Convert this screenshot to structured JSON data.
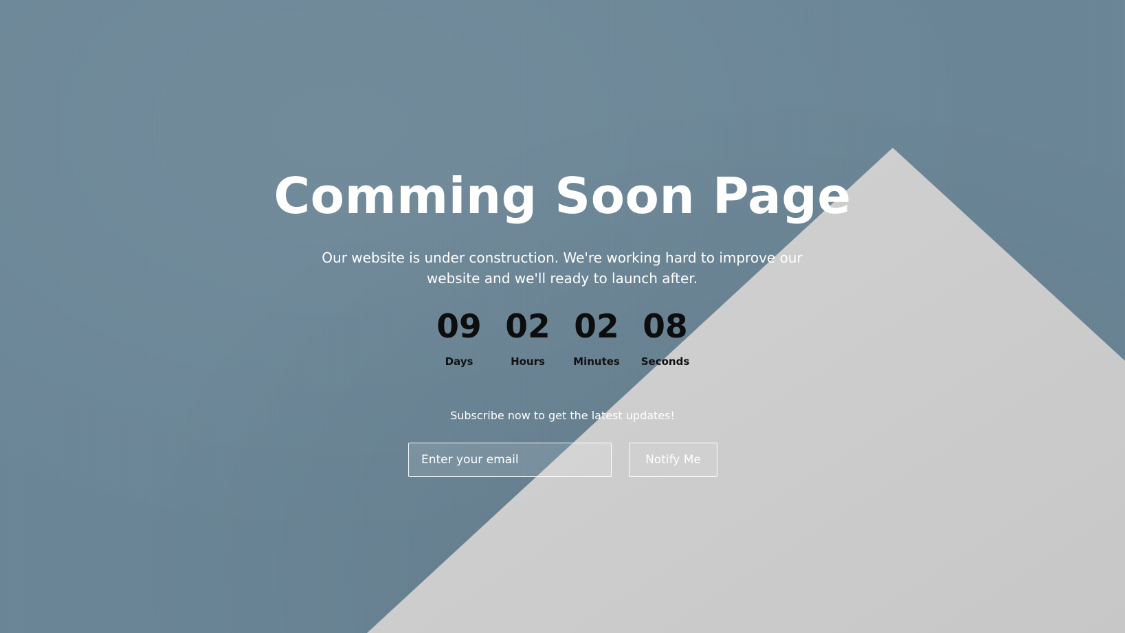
{
  "page": {
    "title": "Comming Soon Page",
    "subtitle": "Our website is under construction. We're working hard to improve our website and we'll ready to launch after."
  },
  "countdown": {
    "days": {
      "value": "09",
      "label": "Days"
    },
    "hours": {
      "value": "02",
      "label": "Hours"
    },
    "minutes": {
      "value": "02",
      "label": "Minutes"
    },
    "seconds": {
      "value": "08",
      "label": "Seconds"
    }
  },
  "subscribe": {
    "text": "Subscribe now to get the latest updates!",
    "email_placeholder": "Enter your email",
    "button_label": "Notify Me"
  },
  "colors": {
    "background": "#6a8596",
    "accent_shape": "#cfcfcf",
    "heading_text": "#ffffff",
    "countdown_text": "#0d0d0d"
  }
}
